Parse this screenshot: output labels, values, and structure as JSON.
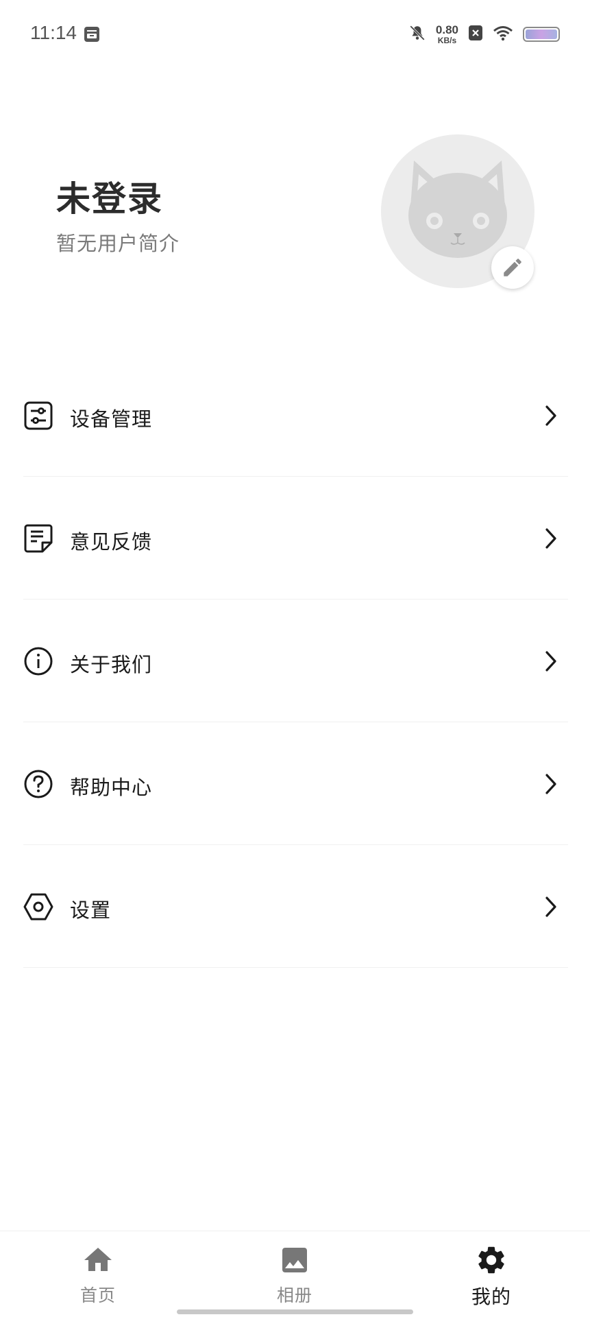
{
  "status_bar": {
    "time": "11:14",
    "net_speed_value": "0.80",
    "net_speed_unit": "KB/s",
    "icons": [
      "calendar-icon",
      "bell-muted-icon",
      "sim-off-icon",
      "wifi-icon",
      "battery-icon"
    ]
  },
  "profile": {
    "name": "未登录",
    "bio": "暂无用户简介",
    "avatar": "cat-avatar",
    "edit_icon": "pencil-icon"
  },
  "menu": {
    "items": [
      {
        "label": "设备管理",
        "icon": "sliders-icon"
      },
      {
        "label": "意见反馈",
        "icon": "feedback-document-icon"
      },
      {
        "label": "关于我们",
        "icon": "info-circle-icon"
      },
      {
        "label": "帮助中心",
        "icon": "question-circle-icon"
      },
      {
        "label": "设置",
        "icon": "hexagon-settings-icon"
      }
    ]
  },
  "bottom_nav": {
    "items": [
      {
        "label": "首页",
        "icon": "home-icon",
        "active": false
      },
      {
        "label": "相册",
        "icon": "image-icon",
        "active": false
      },
      {
        "label": "我的",
        "icon": "gear-icon",
        "active": true
      }
    ]
  },
  "colors": {
    "text_primary": "#1a1a1a",
    "text_secondary": "#7a7a7a",
    "nav_inactive": "#888888",
    "avatar_bg": "#ececec"
  }
}
